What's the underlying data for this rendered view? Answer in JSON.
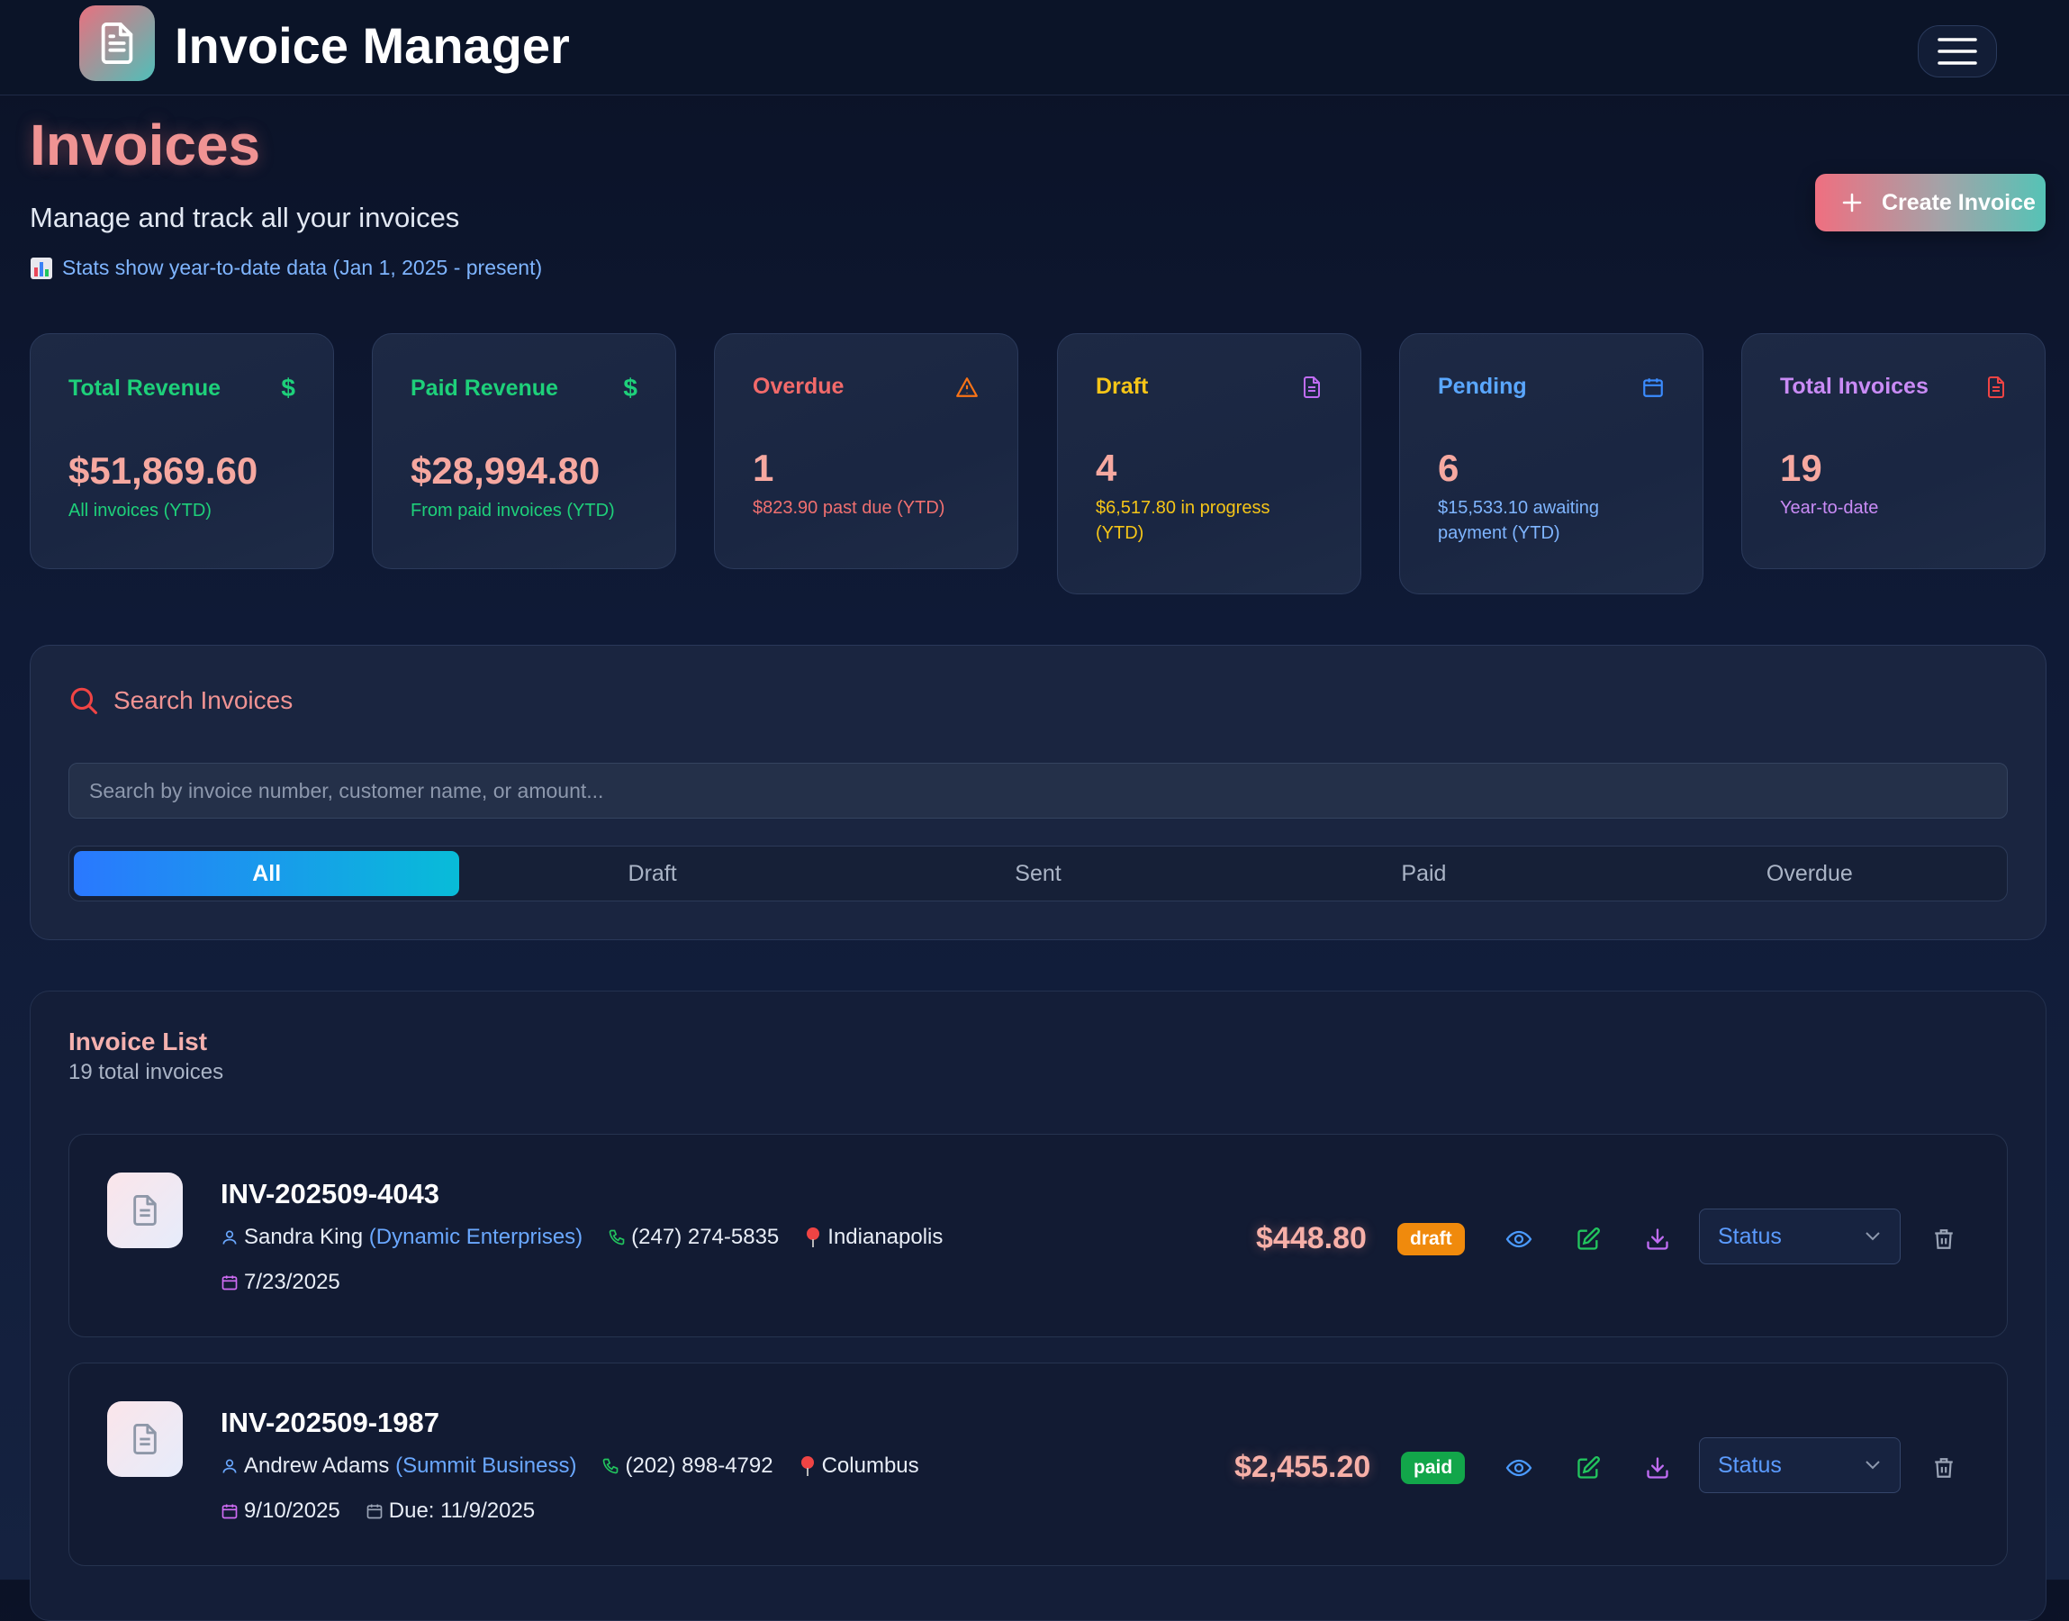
{
  "app": {
    "title": "Invoice Manager"
  },
  "header": {
    "title": "Invoices",
    "subtitle": "Manage and track all your invoices",
    "ytd_note": "Stats show year-to-date data (Jan 1, 2025 - present)",
    "create_label": "Create Invoice"
  },
  "stats": [
    {
      "label": "Total Revenue",
      "value": "$51,869.60",
      "foot": "All invoices (YTD)",
      "color": "#1ed07a",
      "icon": "dollar-icon"
    },
    {
      "label": "Paid Revenue",
      "value": "$28,994.80",
      "foot": "From paid invoices (YTD)",
      "color": "#1ed07a",
      "icon": "dollar-icon"
    },
    {
      "label": "Overdue",
      "value": "1",
      "foot": "$823.90 past due (YTD)",
      "color": "#f26a6a",
      "icon": "warning-icon"
    },
    {
      "label": "Draft",
      "value": "4",
      "foot": "$6,517.80 in progress (YTD)",
      "color": "#f5c518",
      "icon": "document-icon"
    },
    {
      "label": "Pending",
      "value": "6",
      "foot": "$15,533.10 awaiting payment (YTD)",
      "color": "#5aa7ff",
      "icon": "calendar-icon"
    },
    {
      "label": "Total Invoices",
      "value": "19",
      "foot": "Year-to-date",
      "color": "#c98bf5",
      "icon": "document-icon"
    }
  ],
  "search": {
    "title": "Search Invoices",
    "placeholder": "Search by invoice number, customer name, or amount...",
    "tabs": [
      "All",
      "Draft",
      "Sent",
      "Paid",
      "Overdue"
    ],
    "active_tab": "All"
  },
  "list": {
    "title": "Invoice List",
    "count": "19 total invoices",
    "invoices": [
      {
        "number": "INV-202509-4043",
        "customer": "Sandra King",
        "company": "(Dynamic Enterprises)",
        "phone": "(247) 274-5835",
        "city": "Indianapolis",
        "date": "7/23/2025",
        "due": "",
        "amount": "$448.80",
        "status": "draft",
        "status_select": "Status"
      },
      {
        "number": "INV-202509-1987",
        "customer": "Andrew Adams",
        "company": "(Summit Business)",
        "phone": "(202) 898-4792",
        "city": "Columbus",
        "date": "9/10/2025",
        "due": "Due: 11/9/2025",
        "amount": "$2,455.20",
        "status": "paid",
        "status_select": "Status"
      }
    ]
  },
  "colors": {
    "accent_red": "#f09393",
    "accent_blue": "#2a78ff",
    "accent_cyan": "#08bcd8",
    "draft": "#f08a0c",
    "paid": "#12a64a"
  }
}
